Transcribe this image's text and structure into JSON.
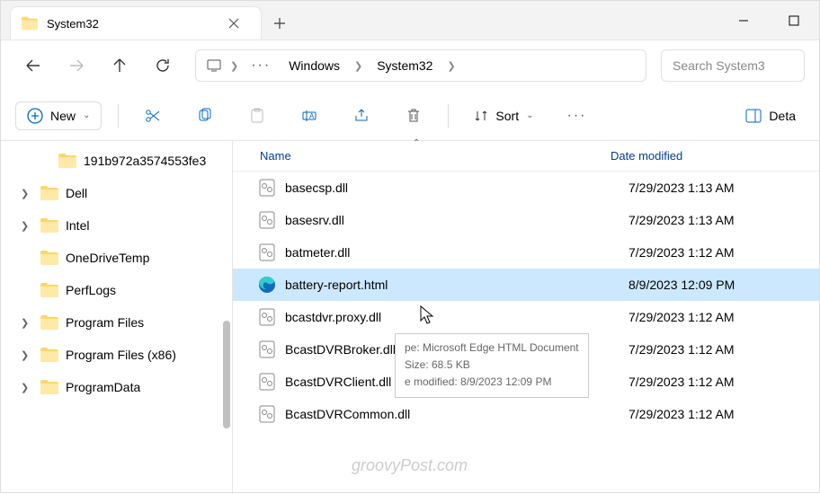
{
  "tab": {
    "title": "System32"
  },
  "nav": {
    "breadcrumb": [
      "Windows",
      "System32"
    ],
    "search_placeholder": "Search System3"
  },
  "toolbar": {
    "new_label": "New",
    "sort_label": "Sort",
    "details_label": "Deta"
  },
  "sidebar": {
    "items": [
      {
        "label": "191b972a3574553fe3",
        "expandable": false,
        "indent": true
      },
      {
        "label": "Dell",
        "expandable": true,
        "indent": false
      },
      {
        "label": "Intel",
        "expandable": true,
        "indent": false
      },
      {
        "label": "OneDriveTemp",
        "expandable": false,
        "indent": false
      },
      {
        "label": "PerfLogs",
        "expandable": false,
        "indent": false
      },
      {
        "label": "Program Files",
        "expandable": true,
        "indent": false
      },
      {
        "label": "Program Files (x86)",
        "expandable": true,
        "indent": false
      },
      {
        "label": "ProgramData",
        "expandable": true,
        "indent": false
      }
    ]
  },
  "columns": {
    "name": "Name",
    "date": "Date modified"
  },
  "files": [
    {
      "name": "basecsp.dll",
      "date": "7/29/2023 1:13 AM",
      "icon": "dll",
      "selected": false
    },
    {
      "name": "basesrv.dll",
      "date": "7/29/2023 1:13 AM",
      "icon": "dll",
      "selected": false
    },
    {
      "name": "batmeter.dll",
      "date": "7/29/2023 1:12 AM",
      "icon": "dll",
      "selected": false
    },
    {
      "name": "battery-report.html",
      "date": "8/9/2023 12:09 PM",
      "icon": "edge",
      "selected": true
    },
    {
      "name": "bcastdvr.proxy.dll",
      "date": "7/29/2023 1:12 AM",
      "icon": "dll",
      "selected": false
    },
    {
      "name": "BcastDVRBroker.dll",
      "date": "7/29/2023 1:12 AM",
      "icon": "dll",
      "selected": false
    },
    {
      "name": "BcastDVRClient.dll",
      "date": "7/29/2023 1:12 AM",
      "icon": "dll",
      "selected": false
    },
    {
      "name": "BcastDVRCommon.dll",
      "date": "7/29/2023 1:12 AM",
      "icon": "dll",
      "selected": false
    }
  ],
  "tooltip": {
    "type_line": "pe: Microsoft Edge HTML Document",
    "size_line": "Size: 68.5 KB",
    "mod_line": "e modified: 8/9/2023 12:09 PM"
  },
  "watermark": "groovyPost.com"
}
